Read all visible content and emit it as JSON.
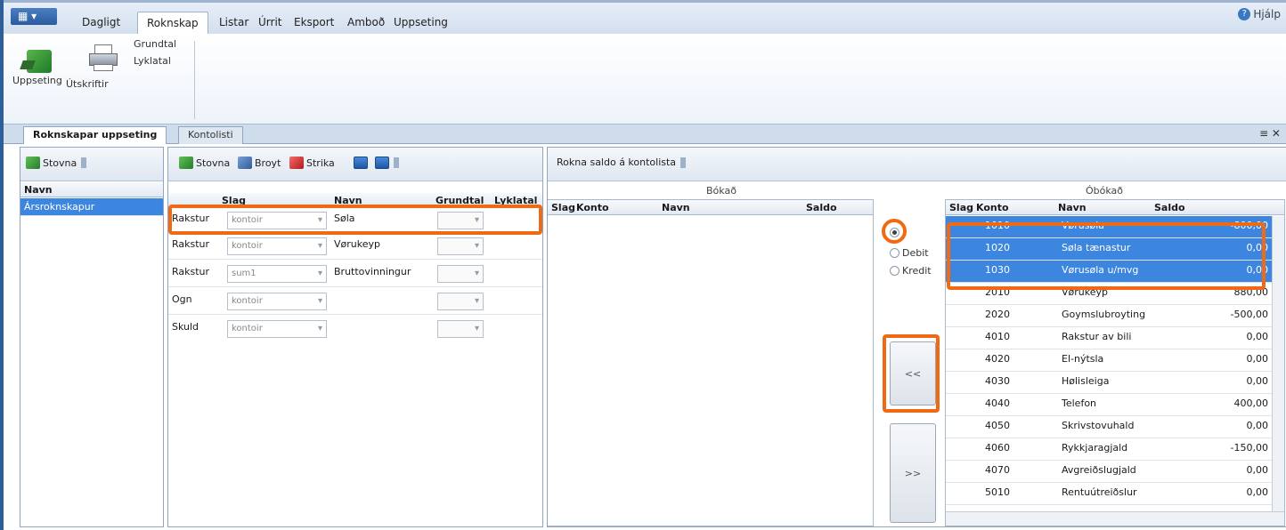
{
  "ribbon": {
    "app_button": "▾",
    "tabs": [
      "Dagligt",
      "Roknskap",
      "Listar",
      "Úrrit",
      "Eksport",
      "Amboð",
      "Uppseting"
    ],
    "active_tab": "Roknskap",
    "help": "Hjálp",
    "buttons": {
      "uppseting": "Uppseting",
      "utskrift": "Útskriftir",
      "grundtal": "Grundtal",
      "lyklatal": "Lyklatal"
    }
  },
  "doc_tabs": {
    "active": "Roknskapar uppseting",
    "inactive": "Kontolisti",
    "pin": "≡ ✕"
  },
  "left_panel": {
    "toolbar_new": "Stovna",
    "header": "Navn",
    "items": [
      "Ársroknskapur"
    ]
  },
  "mid_panel": {
    "toolbar": {
      "new": "Stovna",
      "edit": "Broyt",
      "delete": "Strika"
    },
    "headers": {
      "slag": "Slag",
      "navn": "Navn",
      "grundtal": "Grundtal",
      "lyklatal": "Lyklatal"
    },
    "rows": [
      {
        "type": "Rakstur",
        "slag": "kontoir",
        "navn": "Søla"
      },
      {
        "type": "Rakstur",
        "slag": "kontoir",
        "navn": "Vørukeyp"
      },
      {
        "type": "Rakstur",
        "slag": "sum1",
        "navn": "Bruttovinningur"
      },
      {
        "type": "Ogn",
        "slag": "kontoir",
        "navn": ""
      },
      {
        "type": "Skuld",
        "slag": "kontoir",
        "navn": ""
      }
    ]
  },
  "right_panel": {
    "toolbar": "Rokna saldo á kontolista",
    "booked_title": "Bókað",
    "unbooked_title": "Óbókað",
    "headers": {
      "slag": "Slag",
      "konto": "Konto",
      "navn": "Navn",
      "saldo": "Saldo"
    },
    "radio_debit": "Debit",
    "radio_kredit": "Kredit",
    "move_left": "<<",
    "move_right": ">>",
    "accounts": [
      {
        "konto": "1010",
        "navn": "Vørusøla",
        "saldo": "-800,00",
        "selected": true
      },
      {
        "konto": "1020",
        "navn": "Søla tænastur",
        "saldo": "0,00",
        "selected": true
      },
      {
        "konto": "1030",
        "navn": "Vørusøla u/mvg",
        "saldo": "0,00",
        "selected": true
      },
      {
        "konto": "2010",
        "navn": "Vørukeyp",
        "saldo": "880,00",
        "selected": false
      },
      {
        "konto": "2020",
        "navn": "Goymslubroyting",
        "saldo": "-500,00",
        "selected": false
      },
      {
        "konto": "4010",
        "navn": "Rakstur av bili",
        "saldo": "0,00",
        "selected": false
      },
      {
        "konto": "4020",
        "navn": "El-nýtsla",
        "saldo": "0,00",
        "selected": false
      },
      {
        "konto": "4030",
        "navn": "Hølisleiga",
        "saldo": "0,00",
        "selected": false
      },
      {
        "konto": "4040",
        "navn": "Telefon",
        "saldo": "400,00",
        "selected": false
      },
      {
        "konto": "4050",
        "navn": "Skrivstovuhald",
        "saldo": "0,00",
        "selected": false
      },
      {
        "konto": "4060",
        "navn": "Rykkjaragjald",
        "saldo": "-150,00",
        "selected": false
      },
      {
        "konto": "4070",
        "navn": "Avgreiðslugjald",
        "saldo": "0,00",
        "selected": false
      },
      {
        "konto": "5010",
        "navn": "Rentuútreiðslur",
        "saldo": "0,00",
        "selected": false
      }
    ]
  },
  "colors": {
    "accent": "#3d86e0",
    "highlight": "#ef6a12"
  }
}
